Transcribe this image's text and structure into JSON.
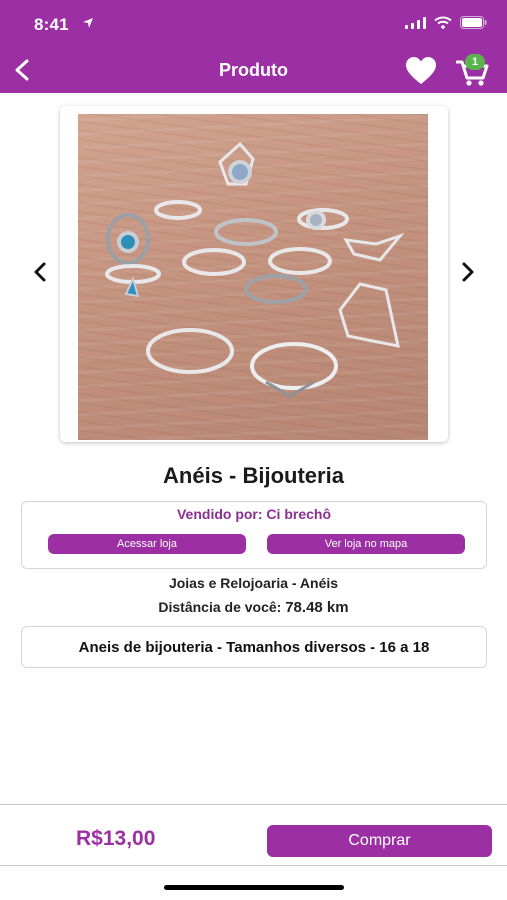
{
  "status_bar": {
    "time": "8:41"
  },
  "header": {
    "title": "Produto",
    "cart_count": "1"
  },
  "product": {
    "title": "Anéis - Bijouteria",
    "seller_label": "Vendido por: Ci brechô",
    "visit_store_label": "Acessar loja",
    "view_map_label": "Ver loja no mapa",
    "category": "Joias e Relojoaria - Anéis",
    "distance_label": "Distância de você:",
    "distance_value": "78.48 km",
    "description": "Aneis de bijouteria - Tamanhos diversos - 16 a 18"
  },
  "purchase": {
    "price": "R$13,00",
    "buy_label": "Comprar"
  },
  "colors": {
    "brand": "#9b2fa3",
    "badge": "#59b44c"
  },
  "icons": {
    "back": "chevron-left-icon",
    "favorite": "heart-icon",
    "cart": "cart-icon",
    "prev": "chevron-left-icon",
    "next": "chevron-right-icon"
  }
}
